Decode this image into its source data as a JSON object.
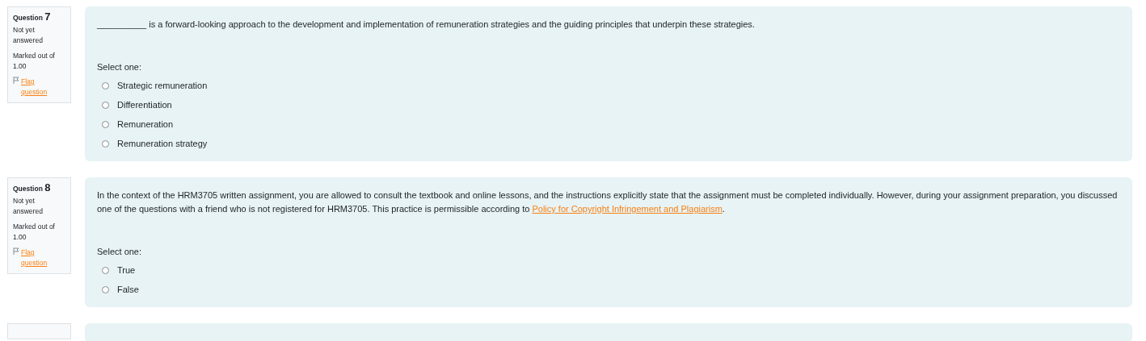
{
  "questions": [
    {
      "label": "Question",
      "number": "7",
      "state": "Not yet answered",
      "marks": "Marked out of 1.00",
      "flag": "Flag question",
      "text": "__________ is a forward-looking approach to the development and implementation of remuneration strategies and the guiding principles that underpin these strategies.",
      "prompt": "Select one:",
      "options": [
        {
          "label": "Strategic remuneration",
          "selected": false
        },
        {
          "label": "Differentiation",
          "selected": false
        },
        {
          "label": "Remuneration",
          "selected": false
        },
        {
          "label": "Remuneration strategy",
          "selected": false
        }
      ]
    },
    {
      "label": "Question",
      "number": "8",
      "state": "Not yet answered",
      "marks": "Marked out of 1.00",
      "flag": "Flag question",
      "text": "In the context of the HRM3705 written assignment, you are allowed to consult the textbook and online lessons, and the instructions explicitly state that the assignment must be completed individually. However, during your assignment preparation, you discussed one of the questions with a friend who is not registered for HRM3705. This practice is permissible according to ",
      "link": "Policy for Copyright Infringement and Plagiarism",
      "text_after": ".",
      "prompt": "Select one:",
      "options": [
        {
          "label": "True",
          "selected": false
        },
        {
          "label": "False",
          "selected": false
        }
      ]
    }
  ]
}
